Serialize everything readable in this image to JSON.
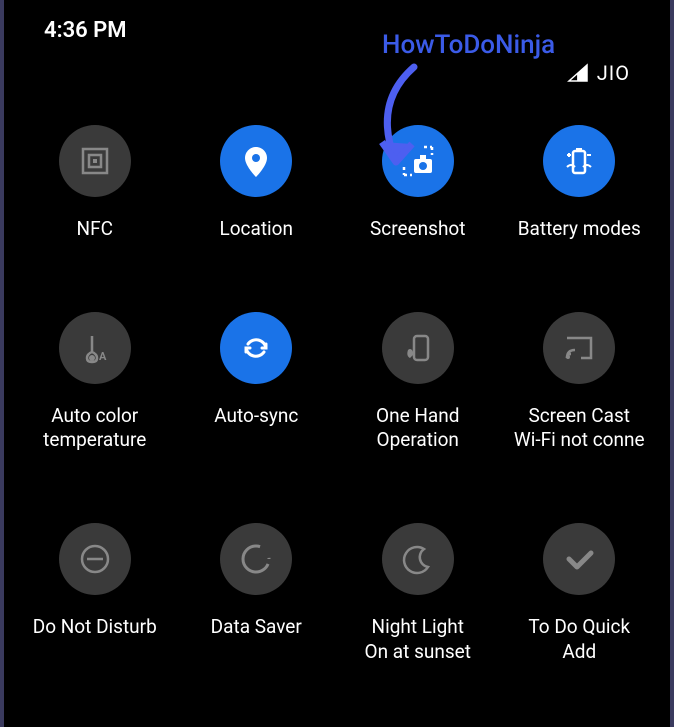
{
  "status_bar": {
    "time": "4:36 PM"
  },
  "annotation": {
    "text": "HowToDoNinja"
  },
  "network": {
    "carrier": "JIO"
  },
  "tiles": [
    {
      "label": "NFC",
      "active": false,
      "icon": "nfc-icon"
    },
    {
      "label": "Location",
      "active": true,
      "icon": "location-icon"
    },
    {
      "label": "Screenshot",
      "active": true,
      "icon": "screenshot-icon"
    },
    {
      "label": "Battery modes",
      "active": true,
      "icon": "battery-icon"
    },
    {
      "label": "Auto color\ntemperature",
      "active": false,
      "icon": "thermometer-icon"
    },
    {
      "label": "Auto-sync",
      "active": true,
      "icon": "sync-icon"
    },
    {
      "label": "One Hand\nOperation",
      "active": false,
      "icon": "onehand-icon"
    },
    {
      "label": "Screen Cast\nWi-Fi not conne",
      "active": false,
      "icon": "cast-icon"
    },
    {
      "label": "Do Not Disturb",
      "active": false,
      "icon": "dnd-icon"
    },
    {
      "label": "Data Saver",
      "active": false,
      "icon": "datasaver-icon"
    },
    {
      "label": "Night Light\nOn at sunset",
      "active": false,
      "icon": "nightlight-icon"
    },
    {
      "label": "To Do Quick\nAdd",
      "active": false,
      "icon": "todo-icon"
    }
  ],
  "colors": {
    "active": "#1a73e8",
    "inactive": "#3a3a3a",
    "annotation": "#3b5be8",
    "icon_active": "#ffffff",
    "icon_inactive": "#888888"
  }
}
